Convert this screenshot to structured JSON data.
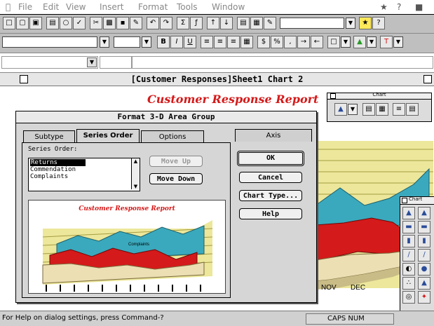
{
  "menubar": {
    "items": [
      "File",
      "Edit",
      "View",
      "Insert",
      "Format",
      "Tools",
      "Window"
    ]
  },
  "window": {
    "title": "[Customer Responses]Sheet1 Chart 2"
  },
  "chart": {
    "title": "Customer Response Report",
    "x_labels": [
      "NOV",
      "DEC"
    ]
  },
  "chart_toolbar": {
    "title": "Chart"
  },
  "chart_type_palette": {
    "title": "Chart"
  },
  "dialog": {
    "title": "Format 3-D Area Group",
    "tabs": [
      "Subtype",
      "Series Order",
      "Options",
      "Axis"
    ],
    "series_order_label": "Series Order:",
    "series": [
      "Returns",
      "Commendation",
      "Complaints"
    ],
    "move_up": "Move Up",
    "move_down": "Move Down",
    "ok": "OK",
    "cancel": "Cancel",
    "chart_type": "Chart Type...",
    "help": "Help",
    "preview_title": "Customer Response Report",
    "preview_series_label": "Complaints"
  },
  "status": {
    "message": "For Help on dialog settings, press Command-?",
    "indicators": "CAPS NUM"
  },
  "colors": {
    "red_series": "#d41a1a",
    "teal_series": "#3aa9bd",
    "floor_yellow": "#ece79a"
  }
}
